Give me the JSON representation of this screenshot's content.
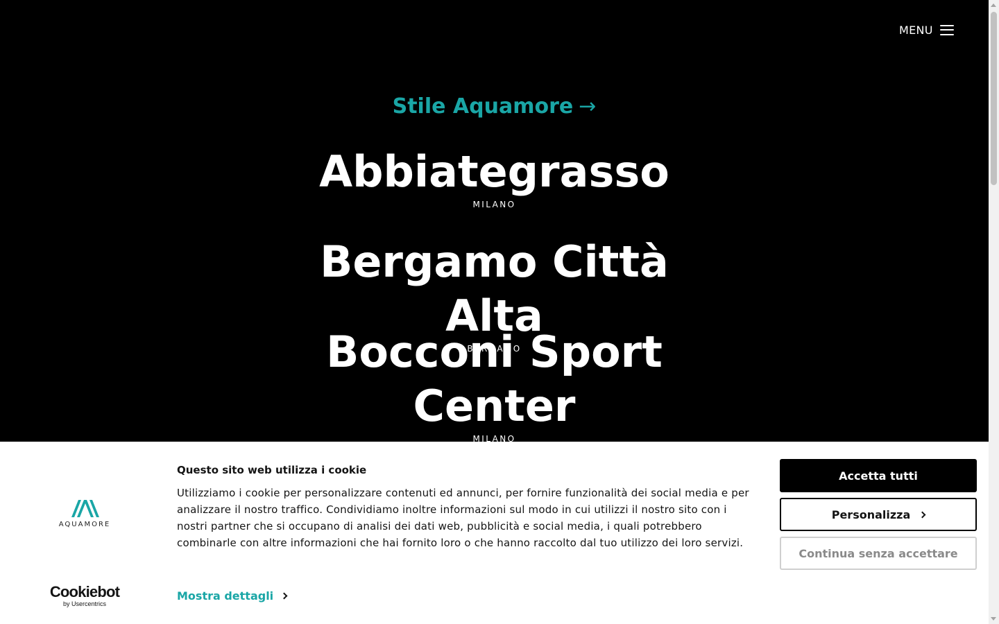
{
  "header": {
    "menu_label": "MENU"
  },
  "hero": {
    "style_link": "Stile Aquamore",
    "style_link_arrow": "→"
  },
  "locations": [
    {
      "name": "Abbiategrasso",
      "city": "MILANO"
    },
    {
      "name": "Bergamo Città Alta",
      "city": "BERGAMO"
    },
    {
      "name": "Bocconi Sport Center",
      "city": "MILANO"
    }
  ],
  "cookie": {
    "brand_name": "AQUAMORE",
    "provider_name": "Cookiebot",
    "provider_sub": "by Usercentrics",
    "title": "Questo sito web utilizza i cookie",
    "body": "Utilizziamo i cookie per personalizzare contenuti ed annunci, per fornire funzionalità dei social media e per analizzare il nostro traffico. Condividiamo inoltre informazioni sul modo in cui utilizzi il nostro sito con i nostri partner che si occupano di analisi dei dati web, pubblicità e social media, i quali potrebbero combinarle con altre informazioni che hai fornito loro o che hanno raccolto dal tuo utilizzo dei loro servizi.",
    "details_link": "Mostra dettagli",
    "accept_label": "Accetta tutti",
    "customize_label": "Personalizza",
    "reject_label": "Continua senza accettare"
  },
  "colors": {
    "accent": "#1aa6a6",
    "background": "#000000",
    "banner": "#ffffff"
  }
}
